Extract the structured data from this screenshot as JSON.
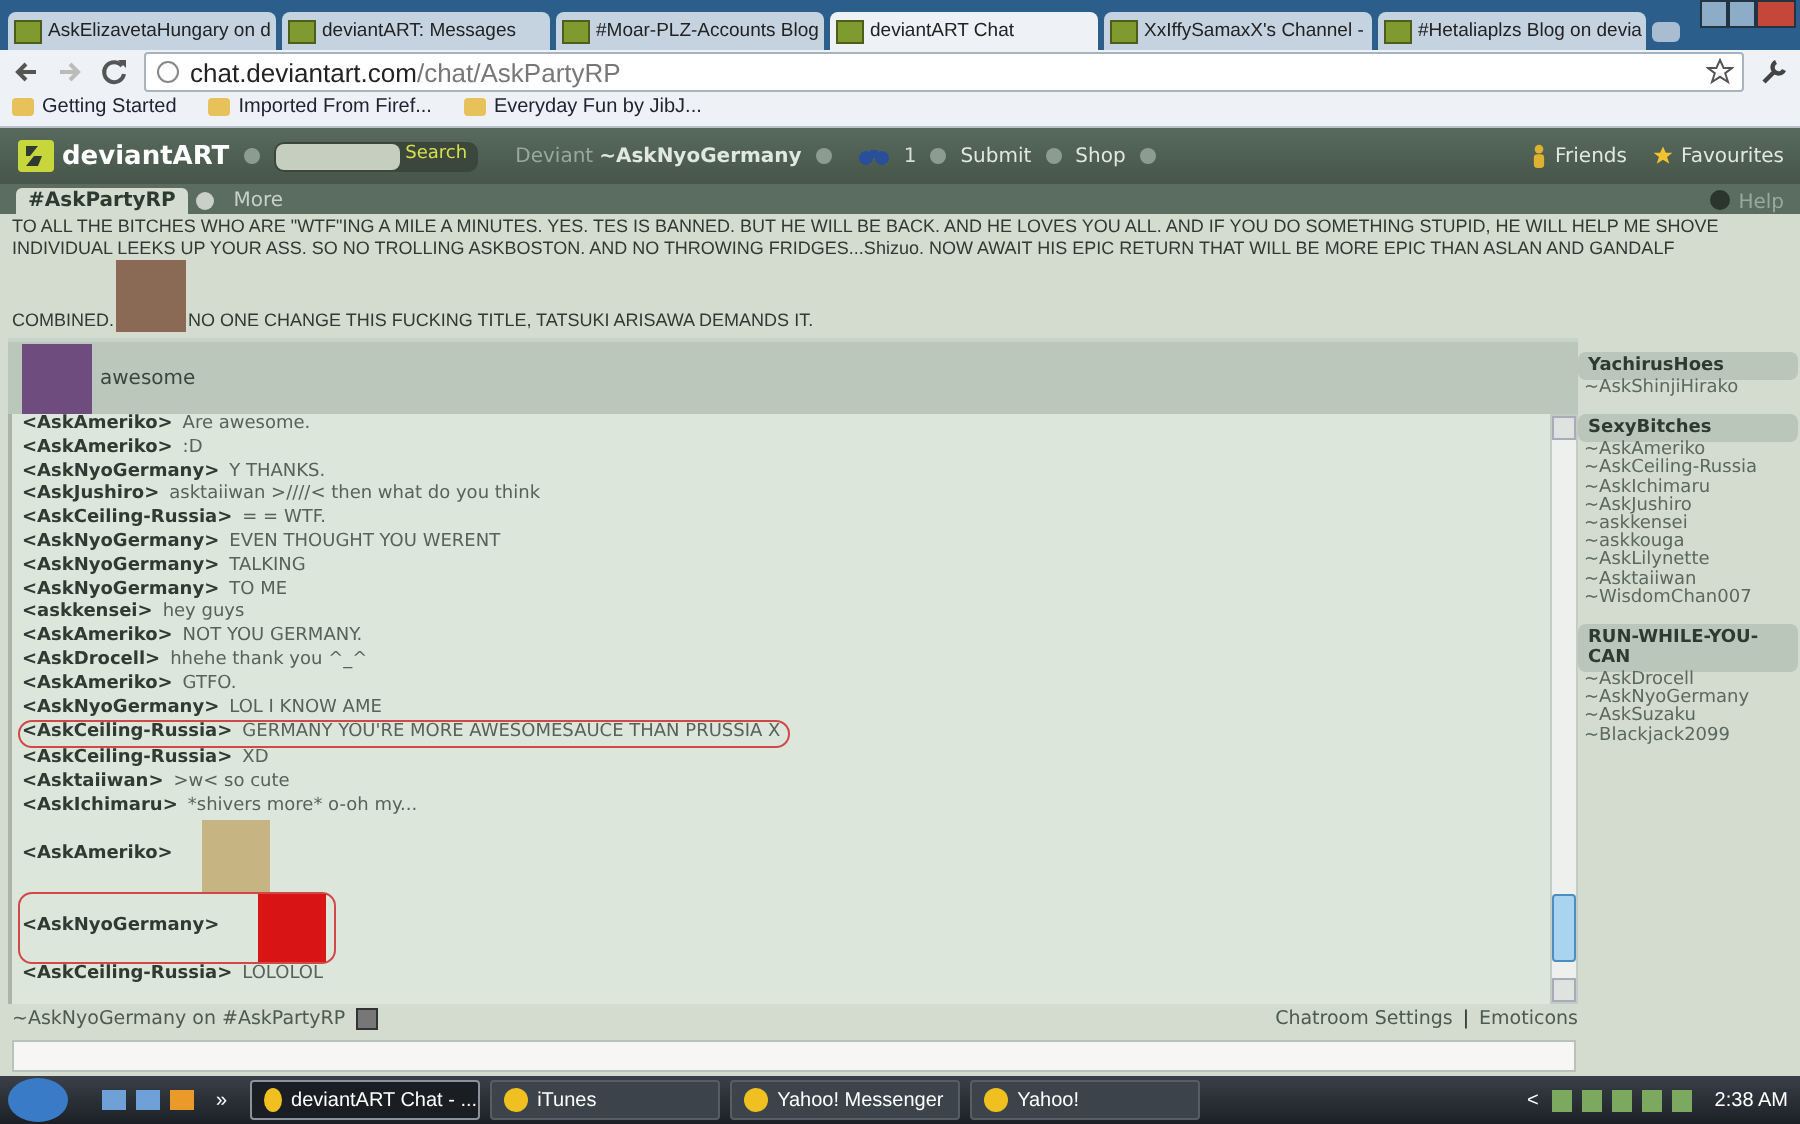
{
  "browser": {
    "tabs": [
      {
        "title": "AskElizavetaHungary on d",
        "selected": false
      },
      {
        "title": "deviantART: Messages",
        "selected": false
      },
      {
        "title": "#Moar-PLZ-Accounts Blog",
        "selected": false
      },
      {
        "title": "deviantART Chat",
        "selected": true
      },
      {
        "title": "XxIffySamaxX's Channel -",
        "selected": false
      },
      {
        "title": "#Hetaliaplzs Blog on devia",
        "selected": false
      }
    ],
    "url_host": "chat.deviantart.com",
    "url_path": "/chat/AskPartyRP",
    "bookmarks": [
      "Getting Started",
      "Imported From Firef...",
      "Everyday Fun by JibJ..."
    ]
  },
  "header": {
    "logo": "deviantART",
    "search_button": "Search",
    "deviant_label": "Deviant",
    "username": "~AskNyoGermany",
    "watch_count": "1",
    "menu": [
      "Submit",
      "Shop"
    ],
    "friends": "Friends",
    "favourites": "Favourites"
  },
  "room_tabs": [
    {
      "label": "#AskPartyRP",
      "selected": true
    },
    {
      "label": "More",
      "selected": false
    }
  ],
  "help": "Help",
  "topic": {
    "text_before": "TO ALL THE BITCHES WHO ARE \"WTF\"ING A MILE A MINUTES. YES. TES IS BANNED. BUT HE WILL BE BACK. AND HE LOVES YOU ALL. AND IF YOU DO SOMETHING STUPID, HE WILL HELP ME SHOVE INDIVIDUAL LEEKS UP YOUR ASS. SO NO TROLLING ASKBOSTON. AND NO THROWING FRIDGES...Shizuo. NOW AWAIT HIS EPIC RETURN THAT WILL BE MORE EPIC THAN ASLAN AND GANDALF",
    "text_last_line": "COMBINED.",
    "text_after": "NO ONE CHANGE THIS FUCKING TITLE, TATSUKI ARISAWA DEMANDS IT."
  },
  "pinned": {
    "text": "awesome"
  },
  "messages": [
    {
      "kind": "text",
      "user": "<AskAmeriko>",
      "text": "Are awesome.",
      "highlighted": false
    },
    {
      "kind": "text",
      "user": "<AskAmeriko>",
      "text": ":D",
      "highlighted": false
    },
    {
      "kind": "text",
      "user": "<AskNyoGermany>",
      "text": "Y THANKS.",
      "highlighted": false
    },
    {
      "kind": "text",
      "user": "<AskJushiro>",
      "text": "asktaiiwan >////< then what do you think",
      "highlighted": false
    },
    {
      "kind": "text",
      "user": "<AskCeiling-Russia>",
      "text": "= = WTF.",
      "highlighted": false
    },
    {
      "kind": "text",
      "user": "<AskNyoGermany>",
      "text": "EVEN THOUGHT YOU WERENT",
      "highlighted": false
    },
    {
      "kind": "text",
      "user": "<AskNyoGermany>",
      "text": "TALKING",
      "highlighted": false
    },
    {
      "kind": "text",
      "user": "<AskNyoGermany>",
      "text": "TO ME",
      "highlighted": false
    },
    {
      "kind": "text",
      "user": "<askkensei>",
      "text": "hey guys",
      "highlighted": false
    },
    {
      "kind": "text",
      "user": "<AskAmeriko>",
      "text": "NOT YOU GERMANY.",
      "highlighted": false
    },
    {
      "kind": "text",
      "user": "<AskDrocell>",
      "text": "hhehe thank you ^_^",
      "highlighted": false
    },
    {
      "kind": "text",
      "user": "<AskAmeriko>",
      "text": "GTFO.",
      "highlighted": false
    },
    {
      "kind": "text",
      "user": "<AskNyoGermany>",
      "text": "LOL I KNOW AME",
      "highlighted": false
    },
    {
      "kind": "text",
      "user": "<AskCeiling-Russia>",
      "text": "GERMANY YOU'RE MORE AWESOMESAUCE THAN PRUSSIA X",
      "highlighted": true
    },
    {
      "kind": "text",
      "user": "<AskCeiling-Russia>",
      "text": "XD",
      "highlighted": false
    },
    {
      "kind": "text",
      "user": "<Asktaiiwan>",
      "text": ">w< so cute",
      "highlighted": false
    },
    {
      "kind": "text",
      "user": "<AskIchimaru>",
      "text": "*shivers more* o-oh my...",
      "highlighted": false
    },
    {
      "kind": "image",
      "user": "<AskAmeriko>",
      "highlighted": false
    },
    {
      "kind": "image",
      "user": "<AskNyoGermany>",
      "highlighted": true
    },
    {
      "kind": "text",
      "user": "<AskCeiling-Russia>",
      "text": "LOLOLOL",
      "highlighted": false
    }
  ],
  "sidebar": [
    {
      "group": "YachirusHoes",
      "members": [
        "~AskShinjiHirako"
      ]
    },
    {
      "group": "SexyBitches",
      "members": [
        "~AskAmeriko",
        "~AskCeiling-Russia",
        "~AskIchimaru",
        "~AskJushiro",
        "~askkensei",
        "~askkouga",
        "~AskLilynette",
        "~Asktaiiwan",
        "~WisdomChan007"
      ]
    },
    {
      "group": "RUN-WHILE-YOU-CAN",
      "members": [
        "~AskDrocell",
        "~AskNyoGermany",
        "~AskSuzaku",
        "~Blackjack2099"
      ]
    }
  ],
  "status": {
    "presence": "~AskNyoGermany on #AskPartyRP",
    "settings": "Chatroom Settings",
    "separator": "|",
    "emoticons": "Emoticons"
  },
  "taskbar": {
    "overflow": "»",
    "tasks": [
      {
        "label": "deviantART Chat - ...",
        "selected": true
      },
      {
        "label": "iTunes",
        "selected": false
      },
      {
        "label": "Yahoo! Messenger",
        "selected": false
      },
      {
        "label": "Yahoo!",
        "selected": false
      }
    ],
    "tray_arrow": "<",
    "clock": "2:38 AM"
  }
}
